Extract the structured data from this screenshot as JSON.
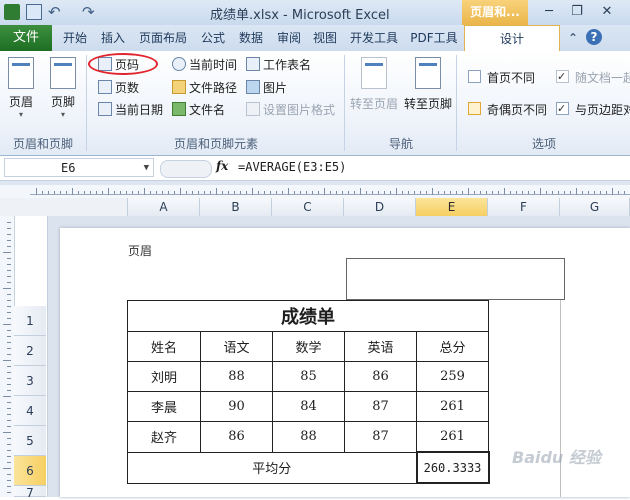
{
  "window": {
    "title": "成绩单.xlsx - Microsoft Excel",
    "context_tab": "页眉和...",
    "minimize_glyph": "─",
    "restore_glyph": "❐",
    "close_glyph": "✕",
    "undo_glyph": "↶",
    "redo_glyph": "↷"
  },
  "tabs": [
    "文件",
    "开始",
    "插入",
    "页面布局",
    "公式",
    "数据",
    "审阅",
    "视图",
    "开发工具",
    "PDF工具",
    "设计"
  ],
  "ribbon": {
    "group_header_footer": {
      "label": "页眉和页脚",
      "header_btn": "页眉",
      "footer_btn": "页脚"
    },
    "group_elements": {
      "label": "页眉和页脚元素",
      "page_number": "页码",
      "page_count": "页数",
      "current_date": "当前日期",
      "current_time": "当前时间",
      "file_path": "文件路径",
      "file_name": "文件名",
      "sheet_name": "工作表名",
      "picture": "图片",
      "format_picture": "设置图片格式"
    },
    "group_nav": {
      "label": "导航",
      "goto_header": "转至页眉",
      "goto_footer": "转至页脚"
    },
    "group_options": {
      "label": "选项",
      "diff_first": "首页不同",
      "odd_even": "奇偶页不同",
      "scale_doc": "随文档一起",
      "align_margins": "与页边距对"
    }
  },
  "formula_bar": {
    "cell_ref": "E6",
    "fx": "fx",
    "formula": "=AVERAGE(E3:E5)"
  },
  "columns": [
    "A",
    "B",
    "C",
    "D",
    "E",
    "F",
    "G"
  ],
  "rows": [
    "1",
    "2",
    "3",
    "4",
    "5",
    "6",
    "7"
  ],
  "page": {
    "header_label": "页眉"
  },
  "sheet": {
    "title": "成绩单",
    "headers": [
      "姓名",
      "语文",
      "数学",
      "英语",
      "总分"
    ],
    "rows": [
      [
        "刘明",
        "88",
        "85",
        "86",
        "259"
      ],
      [
        "李晨",
        "90",
        "84",
        "87",
        "261"
      ],
      [
        "赵齐",
        "86",
        "88",
        "87",
        "261"
      ]
    ],
    "avg_label": "平均分",
    "avg_value": "260.3333"
  },
  "watermark": "Baidu 经验"
}
